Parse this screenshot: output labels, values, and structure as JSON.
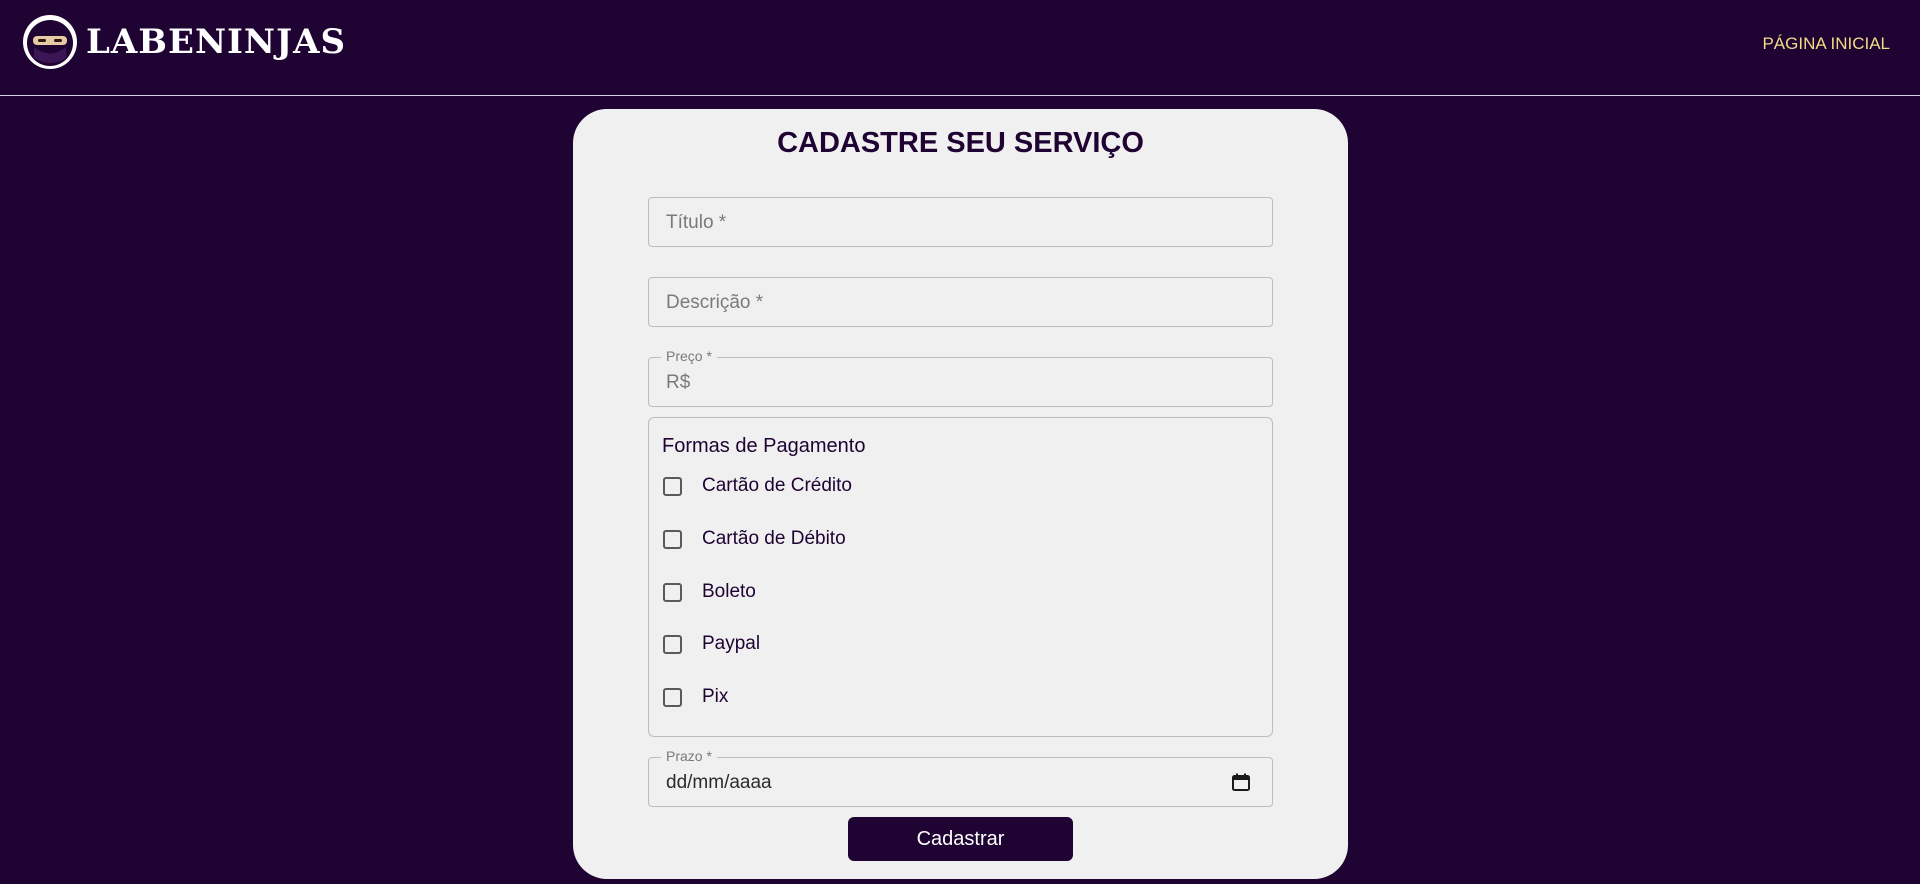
{
  "header": {
    "brand": "LABENINJAS",
    "nav_home": "PÁGINA INICIAL"
  },
  "form": {
    "title": "CADASTRE SEU SERVIÇO",
    "titulo_placeholder": "Título *",
    "descricao_placeholder": "Descrição *",
    "preco_label": "Preço *",
    "preco_prefix": "R$",
    "payment_title": "Formas de Pagamento",
    "payment_options": [
      "Cartão de Crédito",
      "Cartão de Débito",
      "Boleto",
      "Paypal",
      "Pix"
    ],
    "prazo_label": "Prazo *",
    "prazo_value": "dd/mm/aaaa",
    "submit_label": "Cadastrar"
  },
  "colors": {
    "background": "#1e0333",
    "card": "#f0f0f0",
    "nav_link": "#f2dc86",
    "accent": "#1e0333"
  },
  "icons": {
    "logo": "ninja-avatar-icon",
    "date": "calendar-icon"
  }
}
